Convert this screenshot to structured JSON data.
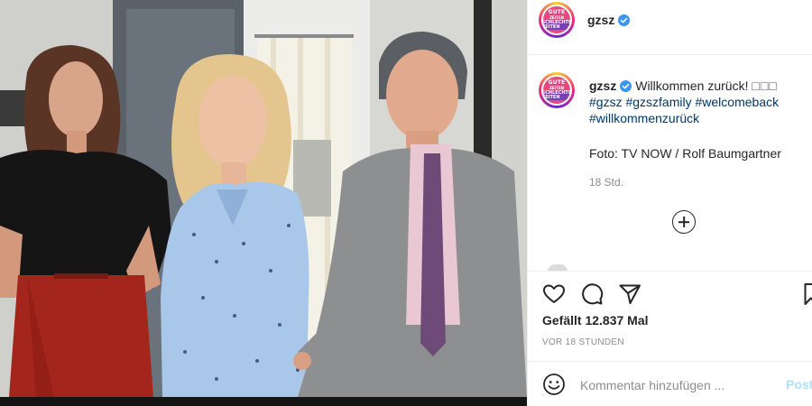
{
  "post": {
    "username": "gzsz",
    "verified": true,
    "avatar_logo_lines": [
      "GUTE",
      "ZEITEN",
      "SCHLECHTE ZEITEN"
    ],
    "caption": {
      "text": "Willkommen zurück!",
      "emoji": "□□□",
      "hashtags": [
        "#gzsz",
        "#gzszfamily",
        "#welcomeback",
        "#willkommenzurück"
      ],
      "credit": "Foto: TV NOW / Rolf Baumgartner",
      "time_ago": "18 Std."
    },
    "likes": "Gefällt 12.837 Mal",
    "posted_ago": "VOR 18 STUNDEN",
    "comment": {
      "placeholder": "Kommentar hinzufügen ...",
      "post_label": "Post"
    }
  },
  "icons": {
    "verified": "verified-badge-icon",
    "load_more": "plus-circle-icon",
    "like": "heart-icon",
    "comment": "comment-bubble-icon",
    "share": "paper-plane-icon",
    "save": "bookmark-icon",
    "emoji": "smiley-icon"
  },
  "colors": {
    "hashtag": "#00376b",
    "verified": "#3897f0",
    "secondary_text": "#8e8e8e",
    "post_button_disabled": "#b2dffc"
  }
}
